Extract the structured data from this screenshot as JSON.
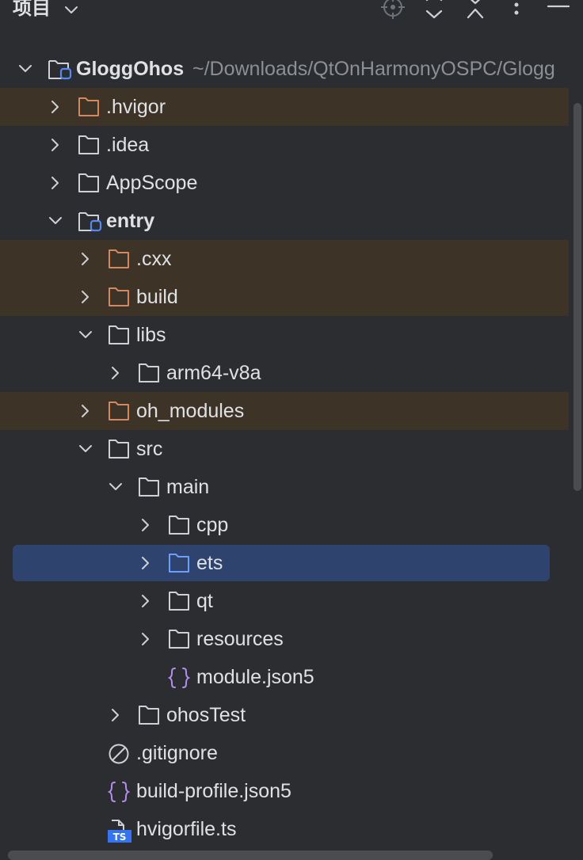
{
  "header": {
    "title": "项目",
    "dropdown_icon": "chevron-down-icon",
    "toolbar_icons": [
      "locate-icon",
      "expand-all-icon",
      "collapse-all-icon",
      "more-icon",
      "minimize-icon"
    ]
  },
  "colors": {
    "background": "#2b2d30",
    "excluded_row": "#3d3326",
    "selected_row": "#2e436e",
    "excluded_folder": "#d6875f",
    "selected_folder": "#6d9eff",
    "module_badge": "#548af7",
    "json_icon": "#b48ef0"
  },
  "tree": {
    "root": {
      "name": "GloggOhos",
      "path": "~/Downloads/QtOnHarmonyOSPC/Glogg"
    },
    "items": [
      {
        "label": ".hvigor",
        "state": "collapsed",
        "icon": "folder-excluded-icon"
      },
      {
        "label": ".idea",
        "state": "collapsed",
        "icon": "folder-icon"
      },
      {
        "label": "AppScope",
        "state": "collapsed",
        "icon": "folder-icon"
      },
      {
        "label": "entry",
        "state": "expanded",
        "icon": "module-folder-icon"
      },
      {
        "label": ".cxx",
        "state": "collapsed",
        "icon": "folder-excluded-icon"
      },
      {
        "label": "build",
        "state": "collapsed",
        "icon": "folder-excluded-icon"
      },
      {
        "label": "libs",
        "state": "expanded",
        "icon": "folder-icon"
      },
      {
        "label": "arm64-v8a",
        "state": "collapsed",
        "icon": "folder-icon"
      },
      {
        "label": "oh_modules",
        "state": "collapsed",
        "icon": "folder-excluded-icon"
      },
      {
        "label": "src",
        "state": "expanded",
        "icon": "folder-icon"
      },
      {
        "label": "main",
        "state": "expanded",
        "icon": "folder-icon"
      },
      {
        "label": "cpp",
        "state": "collapsed",
        "icon": "folder-icon"
      },
      {
        "label": "ets",
        "state": "collapsed",
        "icon": "folder-icon",
        "selected": true
      },
      {
        "label": "qt",
        "state": "collapsed",
        "icon": "folder-icon"
      },
      {
        "label": "resources",
        "state": "collapsed",
        "icon": "folder-icon"
      },
      {
        "label": "module.json5",
        "state": "file",
        "icon": "json-braces-icon"
      },
      {
        "label": "ohosTest",
        "state": "collapsed",
        "icon": "folder-icon"
      },
      {
        "label": ".gitignore",
        "state": "file",
        "icon": "ignore-file-icon"
      },
      {
        "label": "build-profile.json5",
        "state": "file",
        "icon": "json-braces-icon"
      },
      {
        "label": "hvigorfile.ts",
        "state": "file",
        "icon": "typescript-file-icon"
      }
    ]
  }
}
